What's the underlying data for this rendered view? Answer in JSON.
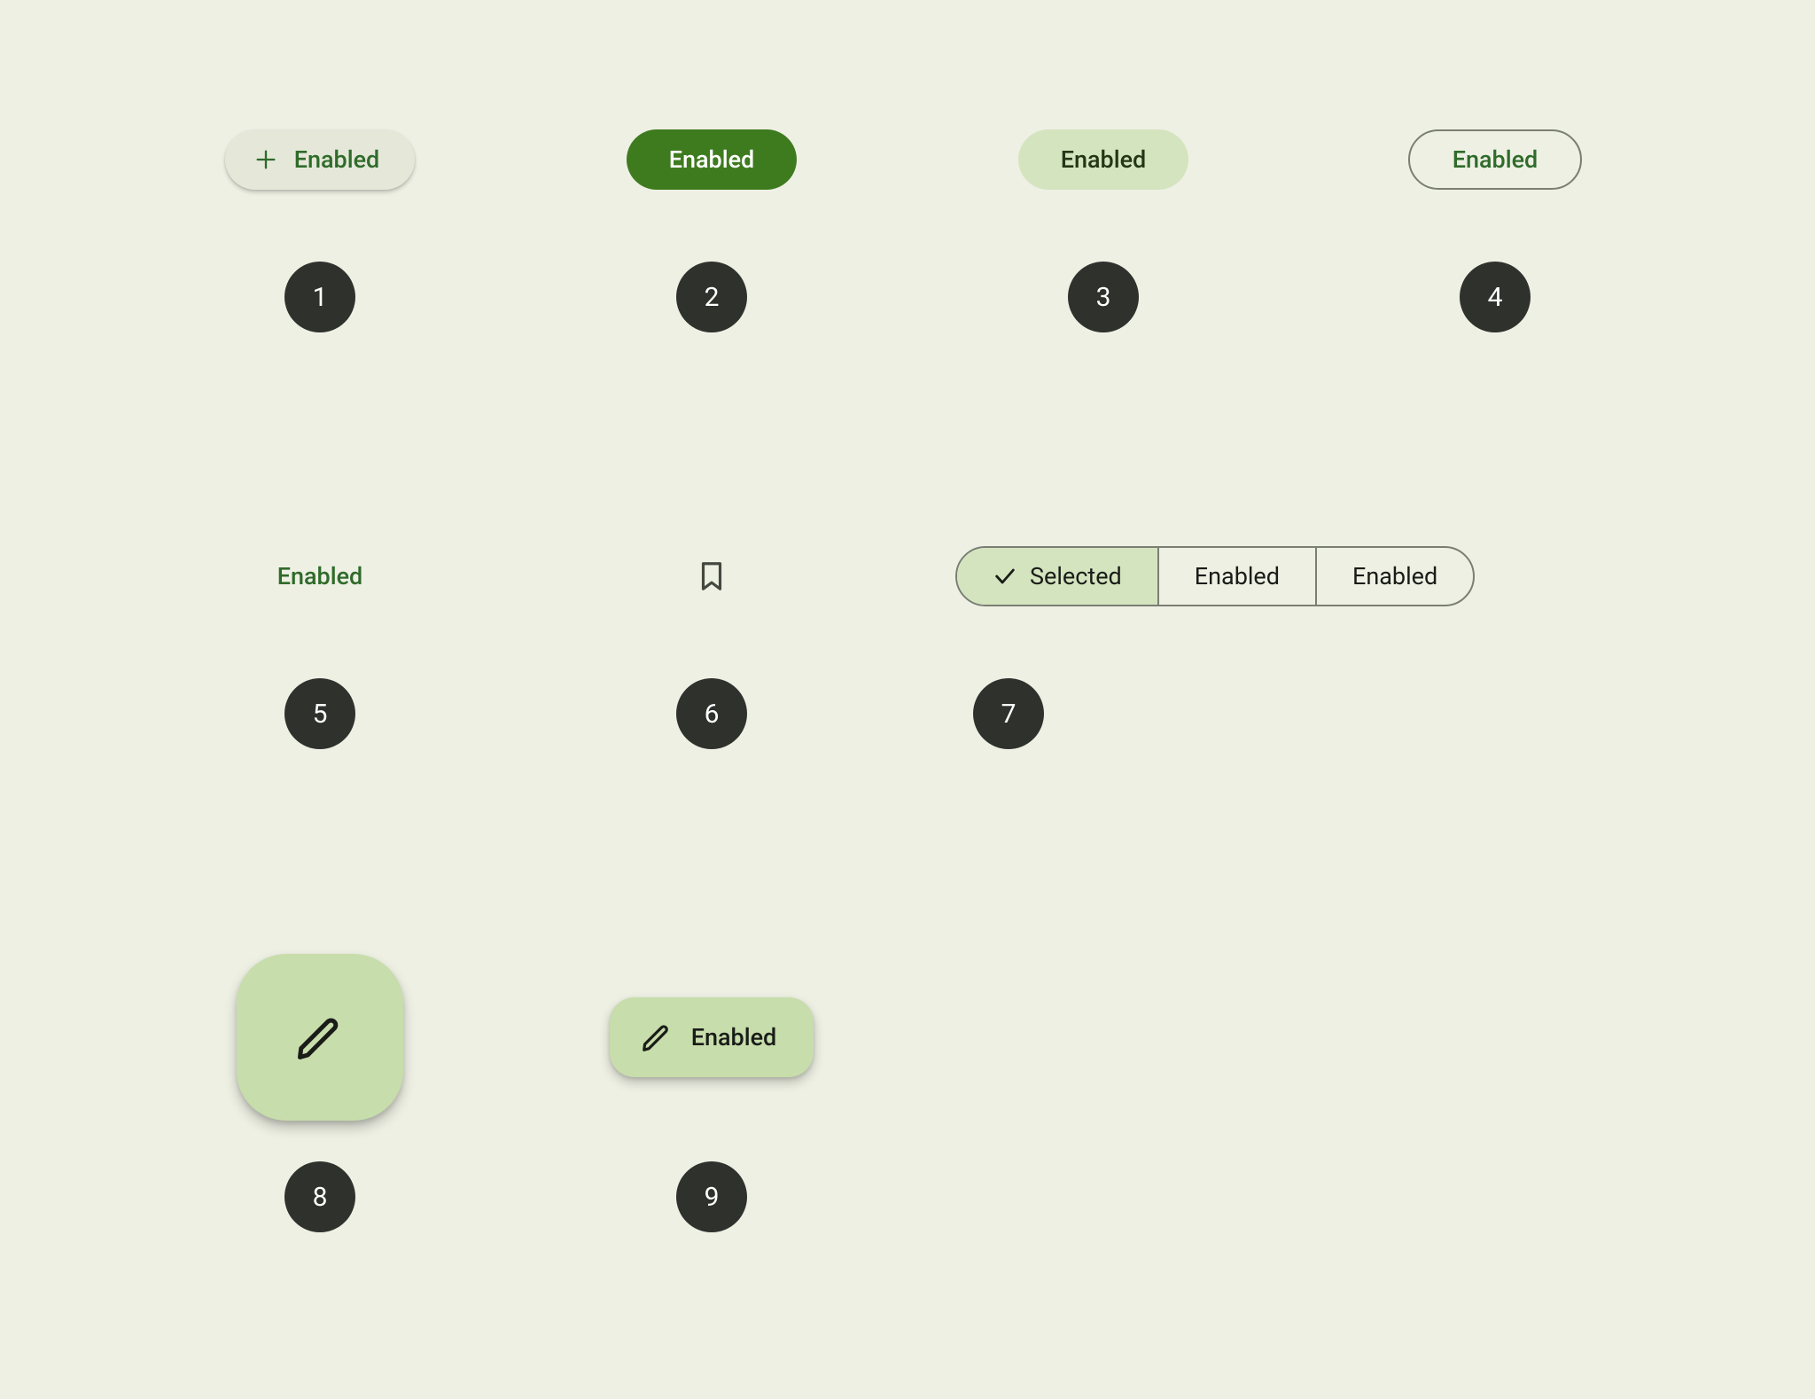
{
  "buttons": {
    "elevated": {
      "label": "Enabled",
      "index": "1"
    },
    "filled": {
      "label": "Enabled",
      "index": "2"
    },
    "tonal": {
      "label": "Enabled",
      "index": "3"
    },
    "outlined": {
      "label": "Enabled",
      "index": "4"
    },
    "text": {
      "label": "Enabled",
      "index": "5"
    },
    "icon": {
      "index": "6"
    },
    "segmented": {
      "index": "7",
      "options": [
        {
          "label": "Selected",
          "selected": true
        },
        {
          "label": "Enabled",
          "selected": false
        },
        {
          "label": "Enabled",
          "selected": false
        }
      ]
    },
    "fab_large": {
      "index": "8"
    },
    "fab_extended": {
      "label": "Enabled",
      "index": "9"
    }
  }
}
